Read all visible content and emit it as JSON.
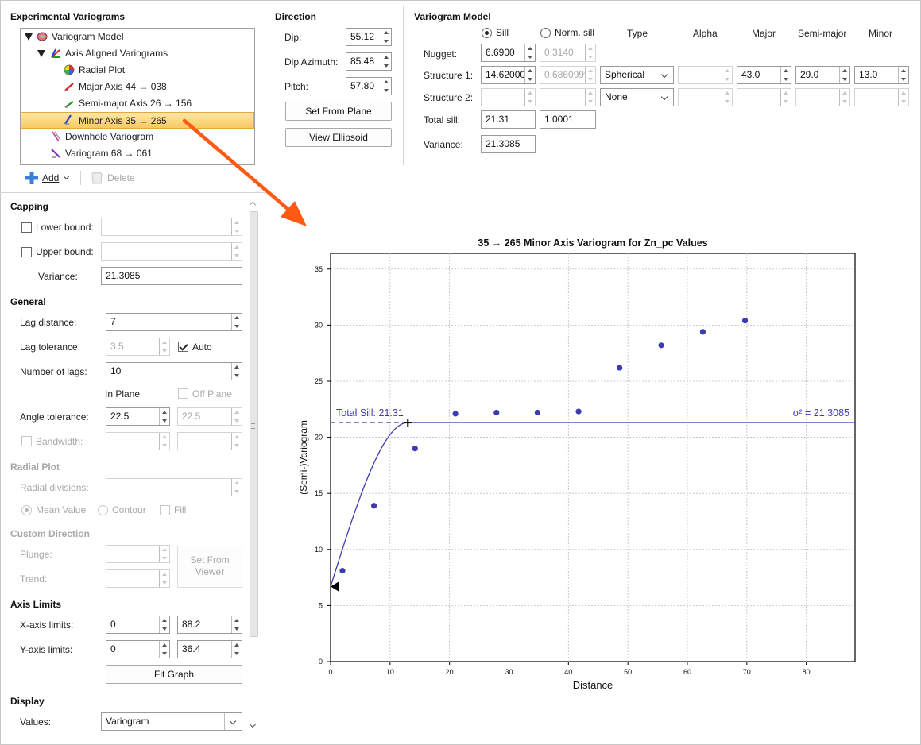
{
  "experimental_variograms": {
    "title": "Experimental Variograms",
    "tree": [
      {
        "label": "Variogram Model",
        "level": 0,
        "icon": "variogram-model-icon",
        "expanded": true
      },
      {
        "label": "Axis Aligned Variograms",
        "level": 1,
        "icon": "axis-aligned-icon",
        "expanded": true
      },
      {
        "label": "Radial Plot",
        "level": 2,
        "icon": "radial-plot-icon"
      },
      {
        "label": "Major Axis 44 → 038",
        "level": 2,
        "icon": "major-axis-icon"
      },
      {
        "label": "Semi-major Axis 26 → 156",
        "level": 2,
        "icon": "semi-major-axis-icon"
      },
      {
        "label": "Minor Axis 35 → 265",
        "level": 2,
        "icon": "minor-axis-icon",
        "selected": true
      },
      {
        "label": "Downhole Variogram",
        "level": 1,
        "icon": "downhole-icon"
      },
      {
        "label": "Variogram 68 → 061",
        "level": 1,
        "icon": "variogram-icon"
      }
    ],
    "add_label": "Add",
    "delete_label": "Delete"
  },
  "capping": {
    "title": "Capping",
    "lower_bound_label": "Lower bound:",
    "upper_bound_label": "Upper bound:",
    "variance_label": "Variance:",
    "variance_value": "21.3085"
  },
  "general": {
    "title": "General",
    "lag_distance_label": "Lag distance:",
    "lag_distance_value": "7",
    "lag_tolerance_label": "Lag tolerance:",
    "lag_tolerance_value": "3.5",
    "auto_label": "Auto",
    "num_lags_label": "Number of lags:",
    "num_lags_value": "10",
    "in_plane_label": "In Plane",
    "off_plane_label": "Off Plane",
    "angle_tolerance_label": "Angle tolerance:",
    "angle_tolerance_in": "22.5",
    "angle_tolerance_off": "22.5",
    "bandwidth_label": "Bandwidth:"
  },
  "radial_plot": {
    "title": "Radial Plot",
    "radial_divisions_label": "Radial divisions:",
    "mean_value_label": "Mean Value",
    "contour_label": "Contour",
    "fill_label": "Fill"
  },
  "custom_direction": {
    "title": "Custom Direction",
    "plunge_label": "Plunge:",
    "trend_label": "Trend:",
    "set_from_viewer_line1": "Set From",
    "set_from_viewer_line2": "Viewer"
  },
  "axis_limits": {
    "title": "Axis Limits",
    "x_label": "X-axis limits:",
    "x_min": "0",
    "x_max": "88.2",
    "y_label": "Y-axis limits:",
    "y_min": "0",
    "y_max": "36.4",
    "fit_graph_label": "Fit Graph"
  },
  "display": {
    "title": "Display",
    "values_label": "Values:",
    "values_value": "Variogram"
  },
  "direction": {
    "title": "Direction",
    "dip_label": "Dip:",
    "dip_value": "55.12",
    "dip_azimuth_label": "Dip Azimuth:",
    "dip_azimuth_value": "85.48",
    "pitch_label": "Pitch:",
    "pitch_value": "57.80",
    "set_from_plane_label": "Set From Plane",
    "view_ellipsoid_label": "View Ellipsoid"
  },
  "variogram_model": {
    "title": "Variogram Model",
    "sill_label": "Sill",
    "norm_sill_label": "Norm. sill",
    "headers": {
      "type": "Type",
      "alpha": "Alpha",
      "major": "Major",
      "semi_major": "Semi-major",
      "minor": "Minor"
    },
    "nugget_label": "Nugget:",
    "nugget_sill": "6.6900",
    "nugget_norm": "0.3140",
    "structure1_label": "Structure 1:",
    "structure1_sill": "14.620000",
    "structure1_norm": "0.6860999",
    "structure1_type": "Spherical",
    "structure1_major": "43.0",
    "structure1_semi_major": "29.0",
    "structure1_minor": "13.0",
    "structure2_label": "Structure 2:",
    "structure2_type": "None",
    "total_sill_label": "Total sill:",
    "total_sill_value": "21.31",
    "total_norm_value": "1.0001",
    "variance_label": "Variance:",
    "variance_value": "21.3085"
  },
  "chart_data": {
    "type": "scatter",
    "title": "35 → 265 Minor Axis Variogram for Zn_pc Values",
    "xlabel": "Distance",
    "ylabel": "(Semi-)Variogram",
    "xlim": [
      0,
      88.2
    ],
    "ylim": [
      0,
      36.4
    ],
    "x_ticks": [
      0,
      10,
      20,
      30,
      40,
      50,
      60,
      70,
      80
    ],
    "y_ticks": [
      0,
      5,
      10,
      15,
      20,
      25,
      30,
      35
    ],
    "grid": true,
    "points": [
      {
        "x": 2.0,
        "y": 8.1
      },
      {
        "x": 7.3,
        "y": 13.9
      },
      {
        "x": 14.2,
        "y": 19.0
      },
      {
        "x": 21.0,
        "y": 22.1
      },
      {
        "x": 27.9,
        "y": 22.2
      },
      {
        "x": 34.8,
        "y": 22.2
      },
      {
        "x": 41.7,
        "y": 22.3
      },
      {
        "x": 48.6,
        "y": 26.2
      },
      {
        "x": 55.6,
        "y": 28.2
      },
      {
        "x": 62.6,
        "y": 29.4
      },
      {
        "x": 69.7,
        "y": 30.4
      }
    ],
    "model": {
      "nugget": 6.69,
      "sill": 14.62,
      "range": 13.0,
      "type": "spherical"
    },
    "total_sill": 21.31,
    "total_sill_label": "Total Sill: 21.31",
    "variance_label": "σ² = 21.3085",
    "point_color": "#3c3cb0",
    "line_color": "#3c3cb0"
  },
  "colors": {
    "selection": "#f8c962",
    "arrow": "#ff5a14",
    "accent": "#3c3cb0"
  }
}
